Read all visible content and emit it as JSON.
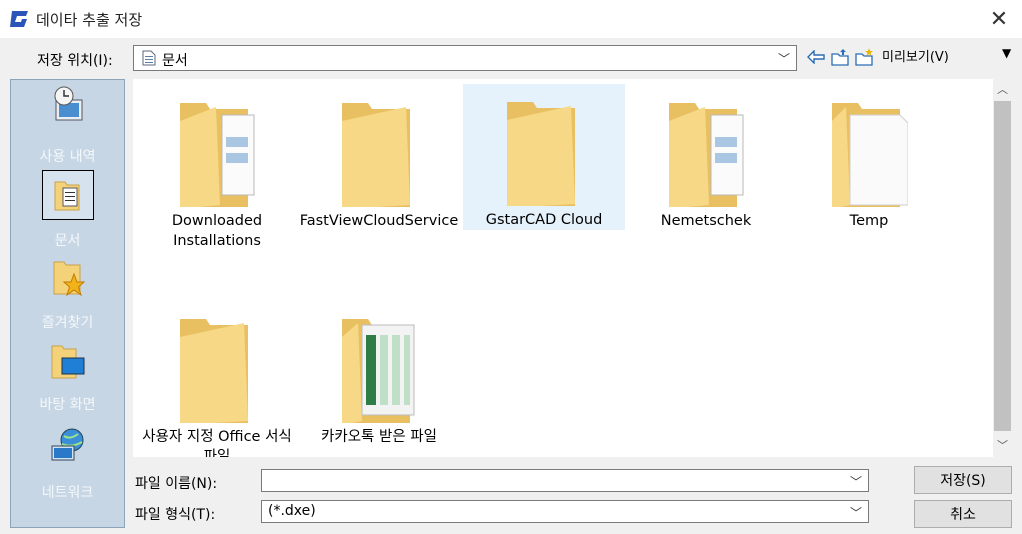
{
  "window": {
    "title": "데이타 추출 저장",
    "close_glyph": "✕"
  },
  "location": {
    "label": "저장 위치(I):",
    "value": "문서",
    "icon": "document-icon"
  },
  "toolbar": {
    "back_icon": "back-arrow-icon",
    "up_icon": "up-folder-icon",
    "new_folder_icon": "new-folder-icon",
    "preview_label": "미리보기(V)",
    "menu_arrow": "▼"
  },
  "places": [
    {
      "label": "사용 내역",
      "icon": "history-icon"
    },
    {
      "label": "문서",
      "icon": "documents-folder-icon"
    },
    {
      "label": "즐겨찾기",
      "icon": "favorites-folder-icon"
    },
    {
      "label": "바탕 화면",
      "icon": "desktop-folder-icon"
    },
    {
      "label": "네트워크",
      "icon": "network-globe-icon"
    }
  ],
  "items": [
    {
      "label": "Downloaded Installations",
      "type": "folder-docs"
    },
    {
      "label": "FastViewCloudService",
      "type": "folder"
    },
    {
      "label": "GstarCAD Cloud",
      "type": "folder",
      "selected": true
    },
    {
      "label": "Nemetschek",
      "type": "folder-docs"
    },
    {
      "label": "Temp",
      "type": "folder-blank"
    },
    {
      "label": "사용자 지정 Office 서식 파일",
      "type": "folder"
    },
    {
      "label": "카카오톡 받은 파일",
      "type": "folder-sheet"
    }
  ],
  "filename": {
    "label": "파일 이름(N):",
    "value": ""
  },
  "filetype": {
    "label": "파일 형식(T):",
    "value": "(*.dxe)"
  },
  "buttons": {
    "save": "저장(S)",
    "cancel": "취소"
  },
  "colors": {
    "places_bg": "#c7d6e4",
    "selection": "#e5f1fb",
    "folder": "#f3d27a"
  }
}
